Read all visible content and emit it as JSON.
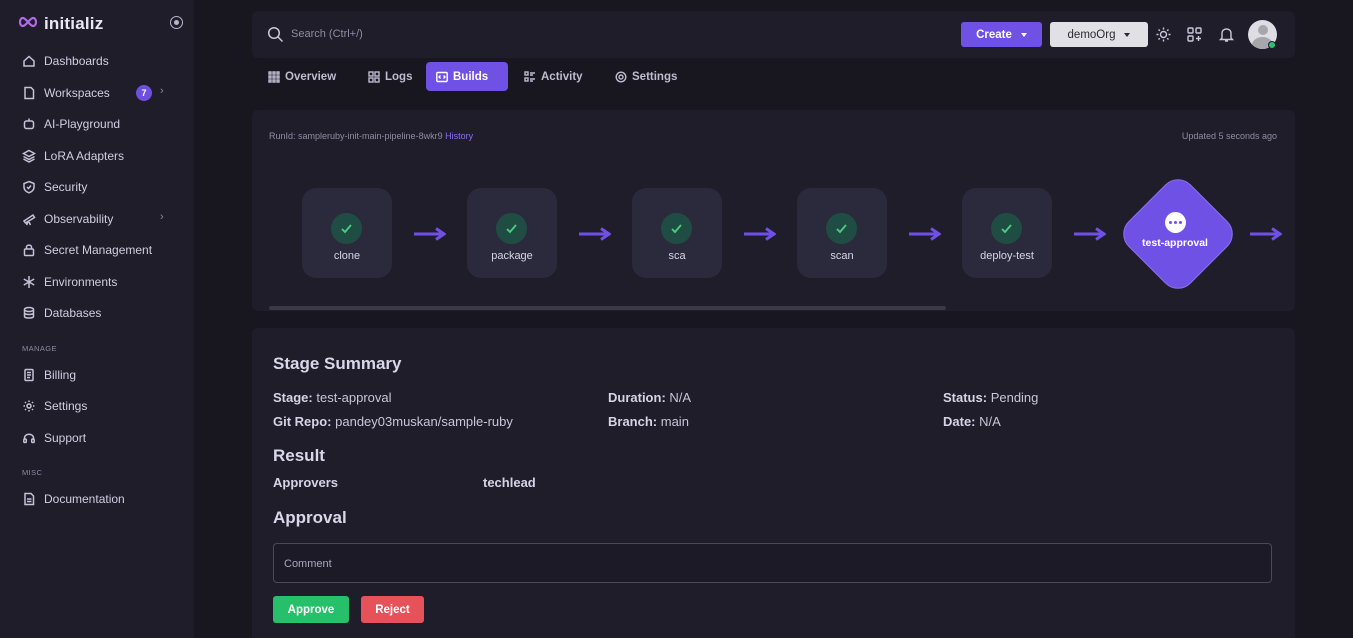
{
  "brand": {
    "name": "initializ"
  },
  "sidebar": {
    "items": [
      {
        "label": "Dashboards",
        "icon": "home-icon"
      },
      {
        "label": "Workspaces",
        "icon": "file-icon",
        "badge": "7"
      },
      {
        "label": "AI-Playground",
        "icon": "robot-icon"
      },
      {
        "label": "LoRA Adapters",
        "icon": "layers-icon"
      },
      {
        "label": "Security",
        "icon": "shield-icon"
      },
      {
        "label": "Observability",
        "icon": "telescope-icon"
      },
      {
        "label": "Secret Management",
        "icon": "lock-icon"
      },
      {
        "label": "Environments",
        "icon": "snowflake-icon"
      },
      {
        "label": "Databases",
        "icon": "database-icon"
      }
    ],
    "manage_label": "MANAGE",
    "manage_items": [
      {
        "label": "Billing",
        "icon": "receipt-icon"
      },
      {
        "label": "Settings",
        "icon": "gear-icon"
      },
      {
        "label": "Support",
        "icon": "headset-icon"
      }
    ],
    "misc_label": "MISC",
    "misc_items": [
      {
        "label": "Documentation",
        "icon": "document-icon"
      }
    ]
  },
  "topbar": {
    "search_placeholder": "Search (Ctrl+/)",
    "create_label": "Create",
    "org_label": "demoOrg"
  },
  "tabs": [
    {
      "label": "Overview",
      "icon": "grid-icon"
    },
    {
      "label": "Logs",
      "icon": "blocks-icon"
    },
    {
      "label": "Builds",
      "icon": "code-icon",
      "active": true
    },
    {
      "label": "Activity",
      "icon": "list-icon"
    },
    {
      "label": "Settings",
      "icon": "gear-icon"
    }
  ],
  "pipeline": {
    "runid_label": "RunId: sampleruby-init-main-pipeline-8wkr9",
    "history_label": "History",
    "updated": "Updated 5 seconds ago",
    "stages": [
      {
        "name": "clone",
        "status": "success"
      },
      {
        "name": "package",
        "status": "success"
      },
      {
        "name": "sca",
        "status": "success"
      },
      {
        "name": "scan",
        "status": "success"
      },
      {
        "name": "deploy-test",
        "status": "success"
      }
    ],
    "current_stage": {
      "name": "test-approval",
      "status": "pending"
    }
  },
  "summary": {
    "title": "Stage Summary",
    "stage_key": "Stage:",
    "stage_val": "test-approval",
    "duration_key": "Duration:",
    "duration_val": "N/A",
    "status_key": "Status:",
    "status_val": "Pending",
    "repo_key": "Git Repo:",
    "repo_val": "pandey03muskan/sample-ruby",
    "branch_key": "Branch:",
    "branch_val": "main",
    "date_key": "Date:",
    "date_val": "N/A",
    "result_title": "Result",
    "approvers_key": "Approvers",
    "approvers_val": "techlead",
    "approval_title": "Approval",
    "comment_placeholder": "Comment",
    "approve_label": "Approve",
    "reject_label": "Reject"
  },
  "colors": {
    "accent": "#7051e5",
    "approve": "#27c06a",
    "reject": "#e5525a",
    "success": "#4ad07c",
    "background": "#18161f",
    "panel": "#1f1d2a"
  }
}
